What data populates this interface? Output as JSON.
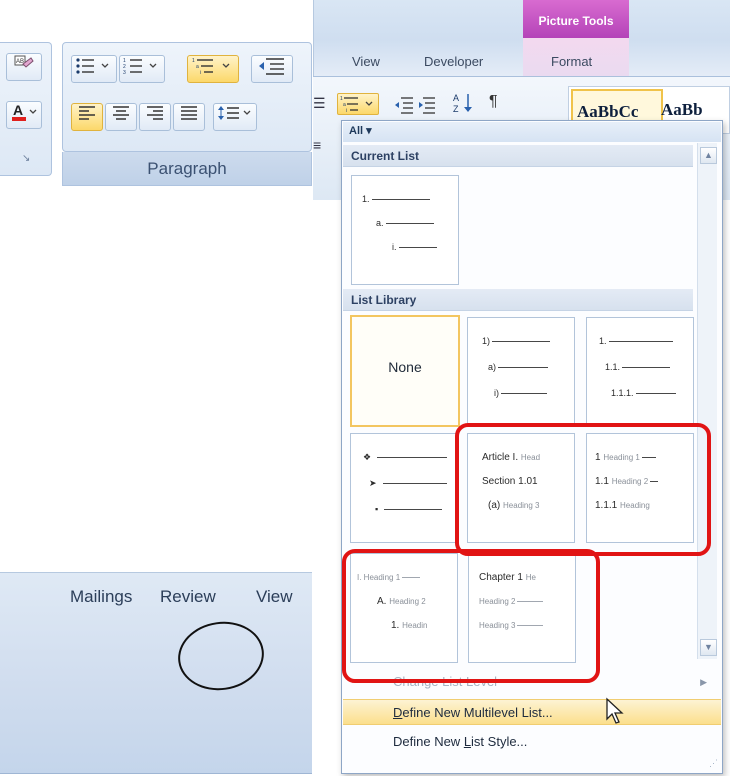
{
  "ribbon_bottom": {
    "tabs": [
      "Mailings",
      "Review",
      "View"
    ],
    "group_label": "Paragraph"
  },
  "ribbon_top": {
    "contextual_tab": "Picture Tools",
    "tabs": [
      "View",
      "Developer",
      "Format"
    ],
    "style_previews": [
      "AaBbCc",
      "AaBb"
    ]
  },
  "dropdown": {
    "filter": "All",
    "current_list_heading": "Current List",
    "current_list": [
      "1.",
      "a.",
      "i."
    ],
    "library_heading": "List Library",
    "none_label": "None",
    "tile_paren": [
      "1)",
      "a)",
      "i)"
    ],
    "tile_decimal": [
      "1.",
      "1.1.",
      "1.1.1."
    ],
    "tile_bullets": [
      "❖",
      "➤",
      "▪"
    ],
    "tile_article": {
      "row1_main": "Article I.",
      "row1_sub": "Head",
      "row2_main": "Section 1.01",
      "row2_sub": "",
      "row3_main": "(a)",
      "row3_sub": "Heading 3"
    },
    "tile_heading_numbered": {
      "row1_main": "1",
      "row1_sub": "Heading 1",
      "row2_main": "1.1",
      "row2_sub": "Heading 2",
      "row3_main": "1.1.1",
      "row3_sub": "Heading"
    },
    "tile_roman": {
      "row1": "I. Heading 1",
      "row2_main": "A.",
      "row2_sub": "Heading 2",
      "row3_main": "1.",
      "row3_sub": "Headin"
    },
    "tile_chapter": {
      "row1_main": "Chapter 1",
      "row1_sub": "He",
      "row2": "Heading 2",
      "row3": "Heading 3"
    },
    "menu": {
      "change_level": "Change List Level",
      "define_multilevel_pre": "",
      "define_multilevel_key": "D",
      "define_multilevel_post": "efine New Multilevel List...",
      "define_style_pre": "Define New ",
      "define_style_key": "L",
      "define_style_post": "ist Style..."
    }
  },
  "colors": {
    "annotation_red": "#e11414",
    "highlight_gold": "#fbdf8d",
    "contextual_tab_magenta": "#c04fc2"
  }
}
